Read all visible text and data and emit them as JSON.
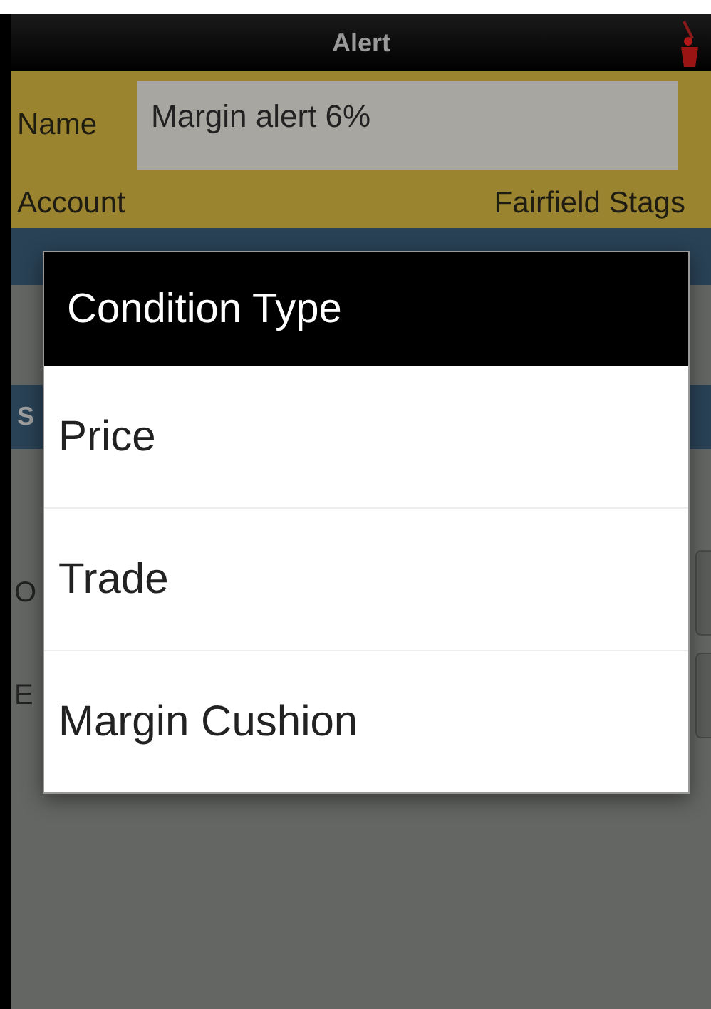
{
  "window": {
    "title": "Alert"
  },
  "form": {
    "name": {
      "label": "Name",
      "value": "Margin alert 6%"
    },
    "account": {
      "label": "Account",
      "value": "Fairfield Stags"
    }
  },
  "section_2": {
    "header": "S"
  },
  "rows": [
    {
      "label": "O"
    },
    {
      "label": "E"
    }
  ],
  "dialog": {
    "title": "Condition Type",
    "options": [
      {
        "label": "Price"
      },
      {
        "label": "Trade"
      },
      {
        "label": "Margin Cushion"
      }
    ]
  }
}
